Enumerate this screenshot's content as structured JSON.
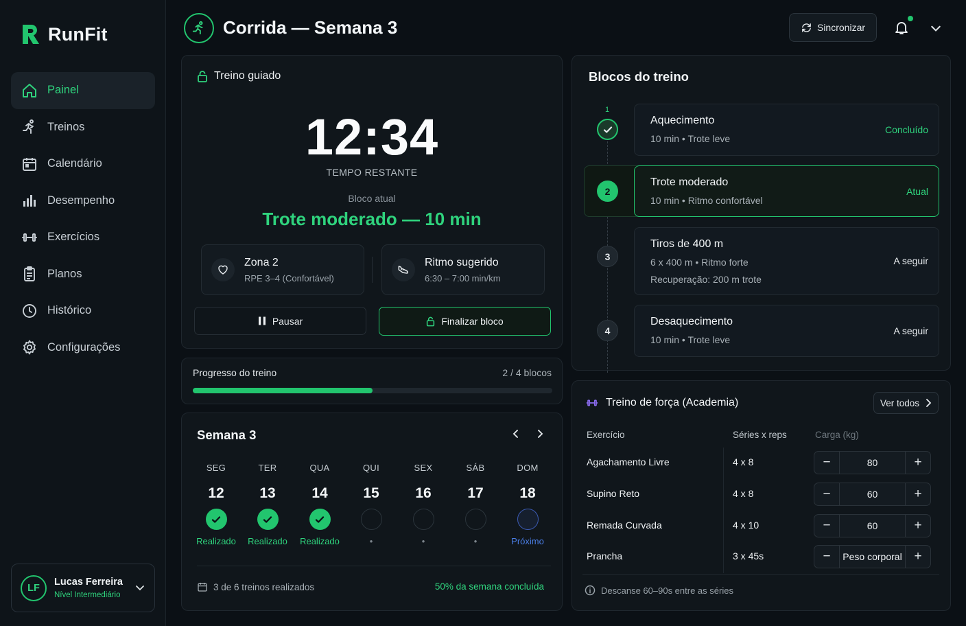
{
  "app": {
    "name": "RunFit"
  },
  "sidebar": {
    "items": [
      {
        "label": "Painel",
        "icon": "home-icon",
        "active": true
      },
      {
        "label": "Treinos",
        "icon": "runner-icon"
      },
      {
        "label": "Calendário",
        "icon": "calendar-icon"
      },
      {
        "label": "Desempenho",
        "icon": "bar-chart-icon"
      },
      {
        "label": "Exercícios",
        "icon": "dumbbell-icon"
      },
      {
        "label": "Planos",
        "icon": "clipboard-icon"
      },
      {
        "label": "Histórico",
        "icon": "clock-icon"
      },
      {
        "label": "Configurações",
        "icon": "gear-icon"
      }
    ],
    "user": {
      "initials": "LF",
      "name": "Lucas Ferreira",
      "level": "Nível Intermediário"
    }
  },
  "header": {
    "title": "Corrida — Semana 3",
    "sync_label": "Sincronizar"
  },
  "guided": {
    "title": "Treino guiado",
    "timer": "12:34",
    "timer_label": "TEMPO RESTANTE",
    "block_label": "Bloco atual",
    "block_name": "Trote moderado — 10 min",
    "zone": {
      "title": "Zona 2",
      "sub": "RPE 3–4 (Confortável)"
    },
    "pace": {
      "title": "Ritmo sugerido",
      "sub": "6:30 – 7:00 min/km"
    },
    "pause_label": "Pausar",
    "finish_label": "Finalizar bloco"
  },
  "progress": {
    "label": "Progresso do treino",
    "count": "2 / 4 blocos",
    "fraction": 0.5
  },
  "week": {
    "title": "Semana 3",
    "days": [
      {
        "name": "SEG",
        "num": "12",
        "status": "Realizado",
        "state": "done"
      },
      {
        "name": "TER",
        "num": "13",
        "status": "Realizado",
        "state": "done"
      },
      {
        "name": "QUA",
        "num": "14",
        "status": "Realizado",
        "state": "done"
      },
      {
        "name": "QUI",
        "num": "15",
        "status": "•",
        "state": "empty"
      },
      {
        "name": "SEX",
        "num": "16",
        "status": "•",
        "state": "empty"
      },
      {
        "name": "SÁB",
        "num": "17",
        "status": "•",
        "state": "empty"
      },
      {
        "name": "DOM",
        "num": "18",
        "status": "Próximo",
        "state": "next"
      }
    ],
    "summary": "3 de 6 treinos realizados",
    "percent": "50% da semana concluída"
  },
  "blocks": {
    "title": "Blocos do treino",
    "step_top": "1",
    "items": [
      {
        "num": "1",
        "name": "Aquecimento",
        "desc": "10 min • Trote leve",
        "status": "Concluído",
        "state": "done"
      },
      {
        "num": "2",
        "name": "Trote moderado",
        "desc": "10 min • Ritmo confortável",
        "status": "Atual",
        "state": "current"
      },
      {
        "num": "3",
        "name": "Tiros de 400 m",
        "desc": "6 x 400 m • Ritmo forte",
        "desc2": "Recuperação: 200 m trote",
        "status": "A seguir",
        "state": "upcoming"
      },
      {
        "num": "4",
        "name": "Desaquecimento",
        "desc": "10 min • Trote leve",
        "status": "A seguir",
        "state": "upcoming"
      }
    ]
  },
  "strength": {
    "title": "Treino de força (Academia)",
    "see_all": "Ver todos",
    "columns": [
      "Exercício",
      "Séries x reps",
      "Carga (kg)"
    ],
    "rows": [
      {
        "exercise": "Agachamento Livre",
        "reps": "4 x 8",
        "load": "80"
      },
      {
        "exercise": "Supino Reto",
        "reps": "4 x 8",
        "load": "60"
      },
      {
        "exercise": "Remada Curvada",
        "reps": "4 x 10",
        "load": "60"
      },
      {
        "exercise": "Prancha",
        "reps": "3 x 45s",
        "load": "Peso corporal"
      }
    ],
    "minus": "−",
    "plus": "+",
    "note": "Descanse 60–90s entre as séries"
  },
  "colors": {
    "accent": "#22c56e",
    "accent_text": "#2fd37d",
    "next": "#4a7ee6",
    "bg": "#0b1015",
    "card": "#10161b"
  }
}
